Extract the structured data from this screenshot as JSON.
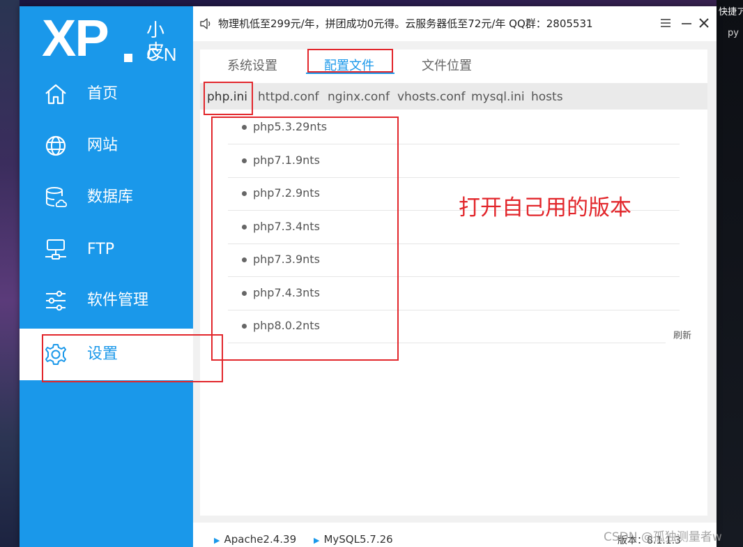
{
  "desktop": {
    "icon_label_1": "快捷ア",
    "icon_label_2": "py"
  },
  "logo": {
    "xp": "XP",
    "cn_top": "小皮",
    "cn_bottom": "CN"
  },
  "sidebar": {
    "items": [
      {
        "label": "首页",
        "icon": "home-icon"
      },
      {
        "label": "网站",
        "icon": "globe-icon"
      },
      {
        "label": "数据库",
        "icon": "database-icon"
      },
      {
        "label": "FTP",
        "icon": "server-icon"
      },
      {
        "label": "软件管理",
        "icon": "sliders-icon"
      },
      {
        "label": "设置",
        "icon": "gear-icon",
        "active": true
      }
    ]
  },
  "topbar": {
    "notice": "物理机低至299元/年，拼团成功0元得。云服务器低至72元/年  QQ群：2805531"
  },
  "tabs": [
    {
      "label": "系统设置"
    },
    {
      "label": "配置文件",
      "active": true
    },
    {
      "label": "文件位置"
    }
  ],
  "subtabs": [
    {
      "label": "php.ini",
      "active": true
    },
    {
      "label": "httpd.conf"
    },
    {
      "label": "nginx.conf"
    },
    {
      "label": "vhosts.conf"
    },
    {
      "label": "mysql.ini"
    },
    {
      "label": "hosts"
    }
  ],
  "versions": [
    "php5.3.29nts",
    "php7.1.9nts",
    "php7.2.9nts",
    "php7.3.4nts",
    "php7.3.9nts",
    "php7.4.3nts",
    "php8.0.2nts"
  ],
  "refresh_label": "刷新",
  "annotation": "打开自己用的版本",
  "statusbar": {
    "apache": "Apache2.4.39",
    "mysql": "MySQL5.7.26",
    "version": "版本：8.1.1.3"
  },
  "watermark": "CSDN @孤独测量者w",
  "colors": {
    "sidebar": "#1a98ea",
    "accent": "#1a98ea",
    "highlight_box": "#e2262b"
  }
}
